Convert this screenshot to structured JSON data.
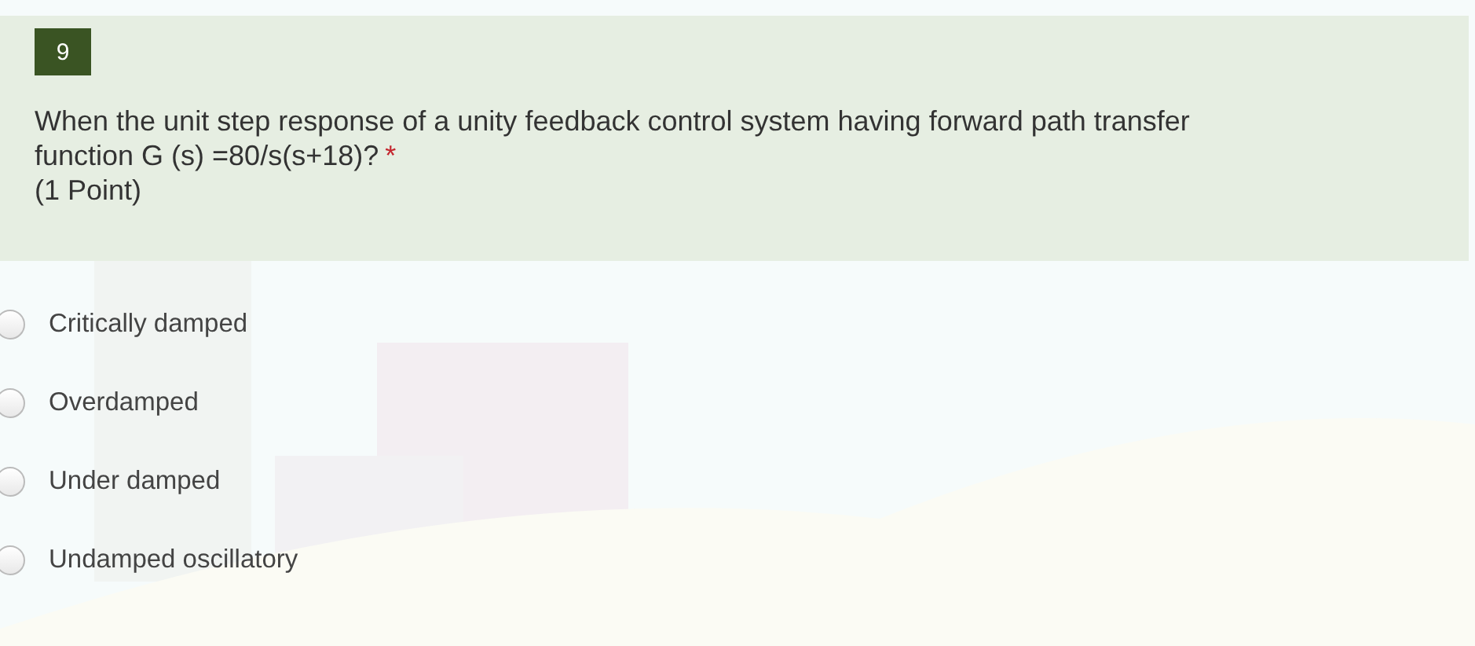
{
  "question": {
    "number": "9",
    "text_lines": [
      "When the unit step response of a unity feedback control system having forward path transfer",
      "function G (s) =80/s(s+18)?"
    ],
    "required_mark": "*",
    "points": "(1 Point)"
  },
  "options": [
    {
      "label": "Critically damped",
      "selected": false
    },
    {
      "label": "Overdamped",
      "selected": false
    },
    {
      "label": "Under damped",
      "selected": false
    },
    {
      "label": "Undamped oscillatory",
      "selected": false
    }
  ]
}
